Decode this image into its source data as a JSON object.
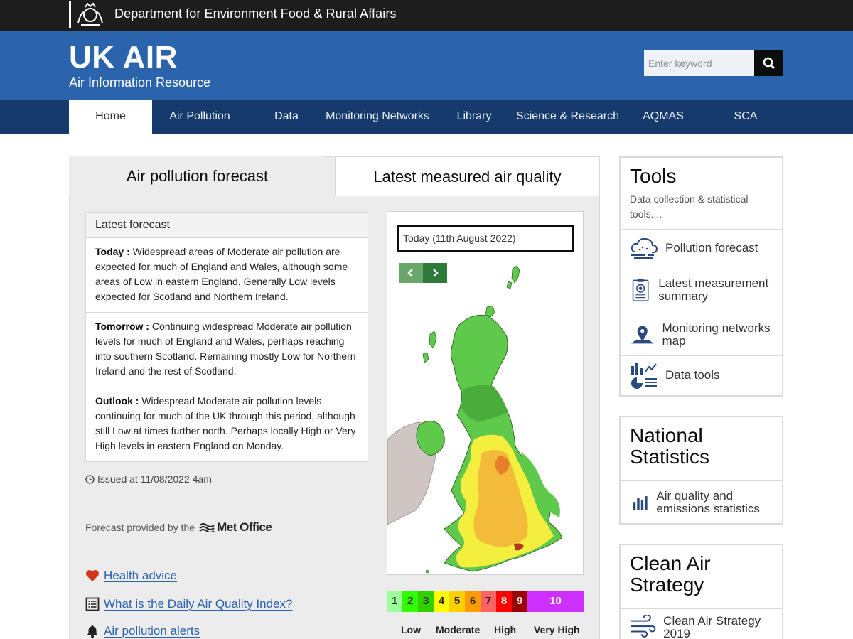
{
  "topbar": {
    "department": "Department for Environment Food & Rural Affairs"
  },
  "header": {
    "title": "UK AIR",
    "subtitle": "Air Information Resource",
    "search_placeholder": "Enter keyword"
  },
  "nav": {
    "items": [
      "Home",
      "Air Pollution",
      "Data",
      "Monitoring Networks",
      "Library",
      "Science & Research",
      "AQMAS",
      "SCA"
    ],
    "active": "Home"
  },
  "tabs": {
    "forecast": "Air pollution forecast",
    "measured": "Latest measured air quality"
  },
  "forecast": {
    "heading": "Latest forecast",
    "today_label": "Today :",
    "today_text": " Widespread areas of Moderate air pollution are expected for much of England and Wales, although some areas of Low in eastern England. Generally Low levels expected for Scotland and Northern Ireland.",
    "tomorrow_label": "Tomorrow :",
    "tomorrow_text": " Continuing widespread Moderate air pollution levels for much of England and Wales, perhaps reaching into southern Scotland. Remaining mostly Low for Northern Ireland and the rest of Scotland.",
    "outlook_label": "Outlook :",
    "outlook_text": " Widespread Moderate air pollution levels continuing for much of the UK through this period, although still Low at times further north. Perhaps locally High or Very High levels in eastern England on Monday.",
    "issued": "Issued at 11/08/2022 4am",
    "provided_by": "Forecast provided by the",
    "provider": "Met Office"
  },
  "links": {
    "health": "Health advice",
    "daqi": "What is the Daily Air Quality Index?",
    "alerts": "Air pollution alerts"
  },
  "map": {
    "date": "Today (11th August 2022)"
  },
  "scale": {
    "bands": [
      {
        "value": "1",
        "color": "#9cff9c"
      },
      {
        "value": "2",
        "color": "#31ff00"
      },
      {
        "value": "3",
        "color": "#31cf00"
      },
      {
        "value": "4",
        "color": "#ffff00"
      },
      {
        "value": "5",
        "color": "#ffcf00"
      },
      {
        "value": "6",
        "color": "#ff9a00"
      },
      {
        "value": "7",
        "color": "#ff6464"
      },
      {
        "value": "8",
        "color": "#ff0000"
      },
      {
        "value": "9",
        "color": "#990000"
      },
      {
        "value": "10",
        "color": "#ce30ff"
      }
    ],
    "labels": [
      "Low",
      "Moderate",
      "High",
      "Very High"
    ]
  },
  "tools": {
    "title": "Tools",
    "description": "Data collection & statistical tools....",
    "items": [
      {
        "label": "Pollution forecast",
        "icon": "cloud-forecast-icon"
      },
      {
        "label": "Latest measurement summary",
        "icon": "clipboard-icon"
      },
      {
        "label": "Monitoring networks map",
        "icon": "map-pin-icon"
      },
      {
        "label": "Data tools",
        "icon": "chart-tools-icon"
      }
    ]
  },
  "national_statistics": {
    "title": "National Statistics",
    "item": "Air quality and emissions statistics"
  },
  "clean_air": {
    "title": "Clean Air Strategy",
    "item": "Clean Air Strategy 2019"
  }
}
